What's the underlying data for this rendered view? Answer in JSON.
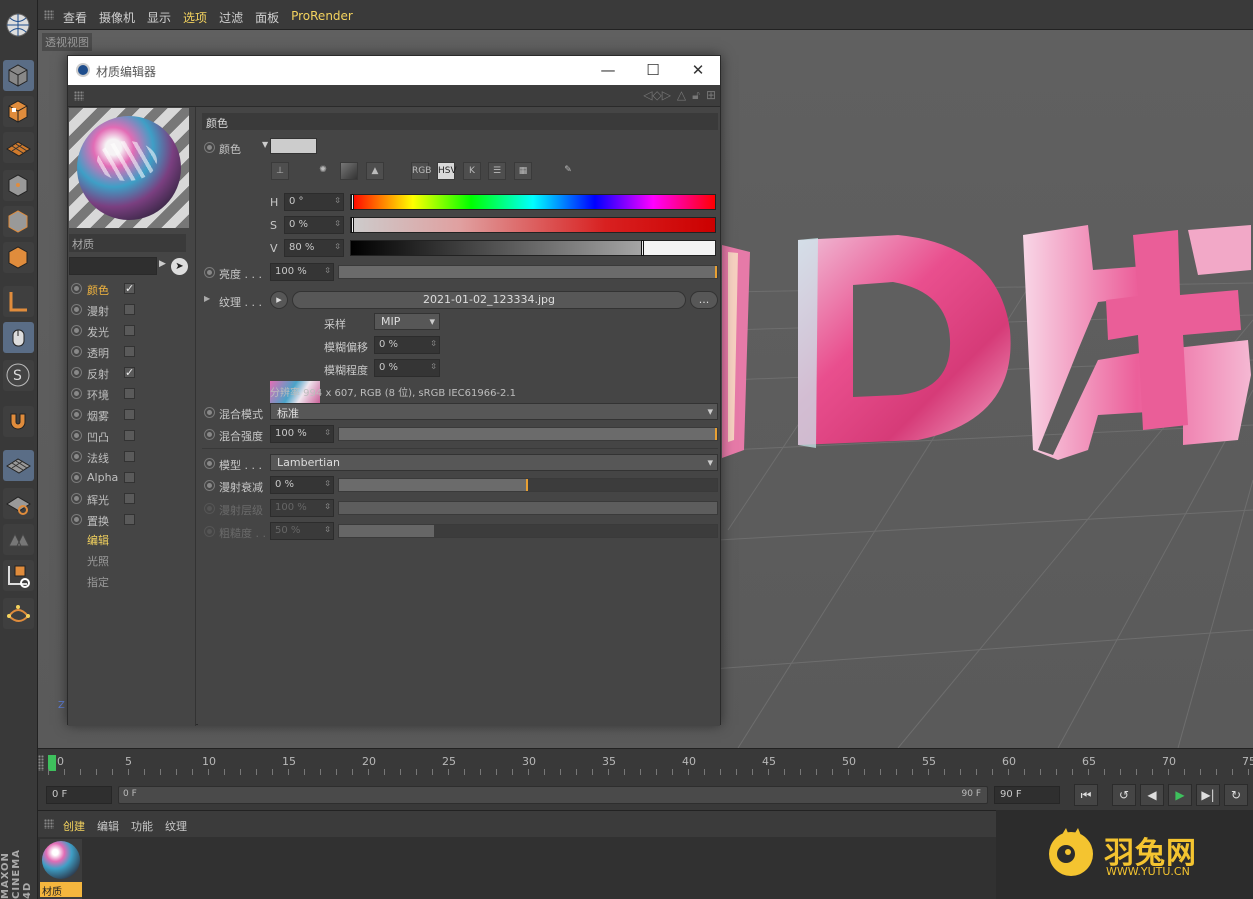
{
  "menubar": {
    "items": [
      "查看",
      "摄像机",
      "显示",
      "选项",
      "过滤",
      "面板",
      "ProRender"
    ]
  },
  "viewport": {
    "label": "透视视图",
    "axis_z": "Z"
  },
  "material_editor": {
    "title": "材质编辑器",
    "material_name": "材质",
    "channels": [
      {
        "label": "颜色",
        "checked": true
      },
      {
        "label": "漫射",
        "checked": false
      },
      {
        "label": "发光",
        "checked": false
      },
      {
        "label": "透明",
        "checked": false
      },
      {
        "label": "反射",
        "checked": true
      },
      {
        "label": "环境",
        "checked": false
      },
      {
        "label": "烟雾",
        "checked": false
      },
      {
        "label": "凹凸",
        "checked": false
      },
      {
        "label": "法线",
        "checked": false
      },
      {
        "label": "Alpha",
        "checked": false
      },
      {
        "label": "辉光",
        "checked": false
      },
      {
        "label": "置换",
        "checked": false
      }
    ],
    "extra": [
      "编辑",
      "光照",
      "指定"
    ],
    "section_title": "颜色",
    "color_label": "颜色",
    "icon_buttons": [
      "RGB",
      "HSV",
      "K"
    ],
    "hsv": {
      "h_label": "H",
      "h_value": "0 °",
      "h_pos": 0.0,
      "s_label": "S",
      "s_value": "0 %",
      "s_pos": 0.0,
      "v_label": "V",
      "v_value": "80 %",
      "v_pos": 0.8
    },
    "brightness": {
      "label": "亮度 . . .",
      "value": "100 %",
      "fill": 1.0
    },
    "texture": {
      "label": "纹理 . . .",
      "file": "2021-01-02_123334.jpg",
      "more": "...",
      "sampling_label": "采样",
      "sampling_value": "MIP",
      "blur_offset_label": "模糊偏移",
      "blur_offset_value": "0 %",
      "blur_scale_label": "模糊程度",
      "blur_scale_value": "0 %",
      "info": "分辨率 994 x 607, RGB (8 位), sRGB IEC61966-2.1"
    },
    "blend_mode": {
      "label": "混合模式",
      "value": "标准"
    },
    "blend_strength": {
      "label": "混合强度",
      "value": "100 %",
      "fill": 1.0
    },
    "model": {
      "label": "模型 . . .",
      "value": "Lambertian"
    },
    "diffuse_falloff": {
      "label": "漫射衰减",
      "value": "0 %",
      "fill": 0.5
    },
    "diffuse_level": {
      "label": "漫射层级",
      "value": "100 %"
    },
    "roughness": {
      "label": "粗糙度 . .",
      "value": "50 %",
      "fill": 0.25
    }
  },
  "timeline": {
    "ruler": [
      "0",
      "5",
      "10",
      "15",
      "20",
      "25",
      "30",
      "35",
      "40",
      "45",
      "50",
      "55",
      "60",
      "65",
      "70",
      "75"
    ],
    "current_frame": "0 F",
    "range_start": "0 F",
    "range_end": "90 F",
    "end_frame": "90 F"
  },
  "material_manager": {
    "menu": [
      "创建",
      "编辑",
      "功能",
      "纹理"
    ],
    "item_name": "材质"
  },
  "branding": {
    "cinema": "MAXON CINEMA 4D"
  },
  "watermark": {
    "name": "羽兔网",
    "url": "WWW.YUTU.CN"
  }
}
